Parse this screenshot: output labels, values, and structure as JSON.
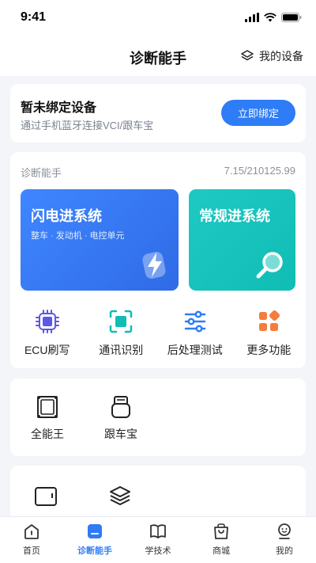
{
  "status": {
    "time": "9:41"
  },
  "header": {
    "title": "诊断能手",
    "my_device": "我的设备"
  },
  "bind_card": {
    "title": "暂未绑定设备",
    "subtitle": "通过手机蓝牙连接VCI/跟车宝",
    "button": "立即绑定"
  },
  "diag": {
    "label": "诊断能手",
    "version": "7.15/210125.99",
    "tiles": [
      {
        "title": "闪电进系统",
        "subtitle": "整车 · 发动机 · 电控单元",
        "icon": "lightning-icon",
        "color": "#2f6be6"
      },
      {
        "title": "常规进系统",
        "icon": "magnifier-icon",
        "color": "#10bdb5"
      }
    ],
    "functions": [
      {
        "label": "ECU刷写",
        "icon": "chip-icon"
      },
      {
        "label": "通讯识别",
        "icon": "scan-icon"
      },
      {
        "label": "后处理测试",
        "icon": "sliders-icon"
      },
      {
        "label": "更多功能",
        "icon": "grid-icon"
      }
    ]
  },
  "tools": [
    {
      "label": "全能王",
      "icon": "device-icon"
    },
    {
      "label": "跟车宝",
      "icon": "dongle-icon"
    }
  ],
  "tabbar": {
    "items": [
      {
        "label": "首页",
        "icon": "home-icon"
      },
      {
        "label": "诊断能手",
        "icon": "diagnose-icon",
        "active": true
      },
      {
        "label": "学技术",
        "icon": "book-icon"
      },
      {
        "label": "商城",
        "icon": "shop-icon"
      },
      {
        "label": "我的",
        "icon": "profile-icon"
      }
    ]
  },
  "colors": {
    "accent": "#2e7cf6",
    "teal": "#10bdb5",
    "orange": "#f57d3b",
    "background": "#f3f5f8"
  }
}
